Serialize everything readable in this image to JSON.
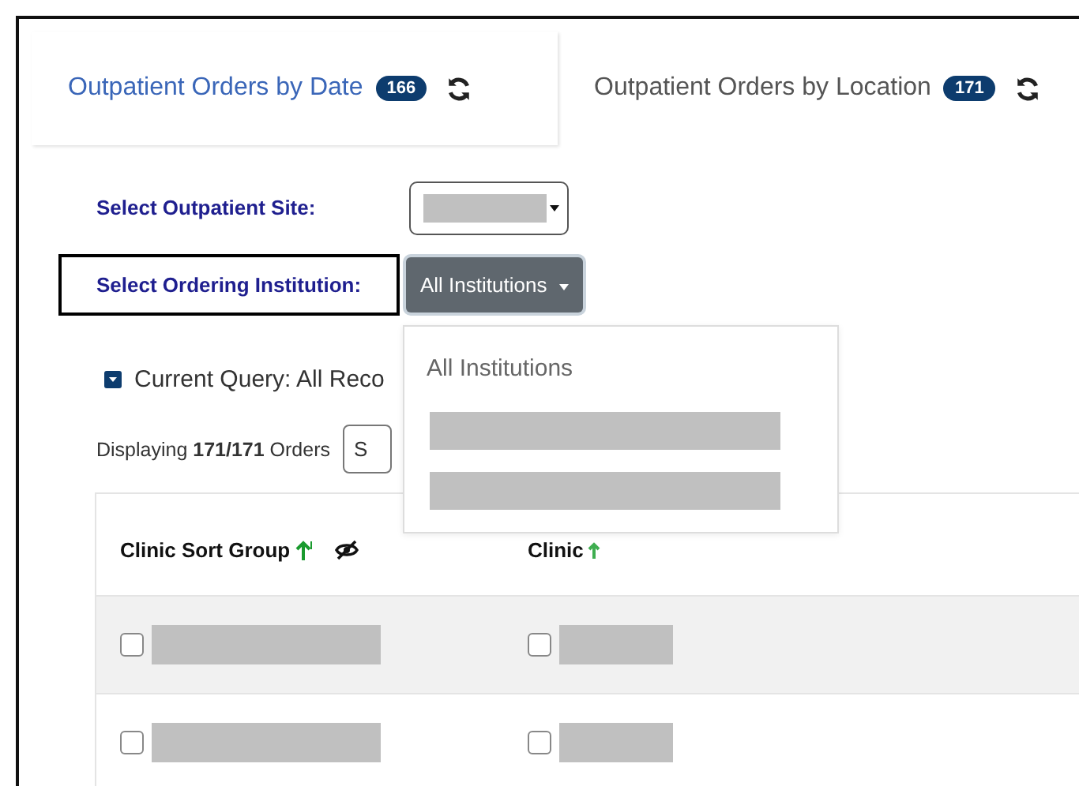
{
  "tabs": [
    {
      "label": "Outpatient Orders by Date",
      "count": "166",
      "selected": true
    },
    {
      "label": "Outpatient Orders by Location",
      "count": "171",
      "selected": false
    }
  ],
  "filters": {
    "site": {
      "label": "Select Outpatient Site:"
    },
    "institution": {
      "label": "Select Ordering Institution:",
      "value": "All Institutions",
      "expanded": true,
      "highlighted": true
    }
  },
  "menu": {
    "items": [
      {
        "kind": "text",
        "label": "All Institutions"
      },
      {
        "kind": "redacted"
      },
      {
        "kind": "redacted"
      }
    ]
  },
  "query": {
    "label": "Current Query: All Reco"
  },
  "display": {
    "text": "Displaying **171/171** Orders",
    "control_text": "S"
  },
  "table": {
    "columns": [
      {
        "kind": "hideable",
        "label": "Clinic Sort Group",
        "sorted": true
      },
      {
        "kind": "plain",
        "label": "Clinic",
        "sorted": false
      }
    ],
    "rows": [
      {
        "cells": [
          {
            "checked": false
          },
          {
            "checked": false
          }
        ]
      },
      {
        "cells": [
          {
            "checked": false
          },
          {
            "checked": false
          }
        ]
      }
    ]
  }
}
